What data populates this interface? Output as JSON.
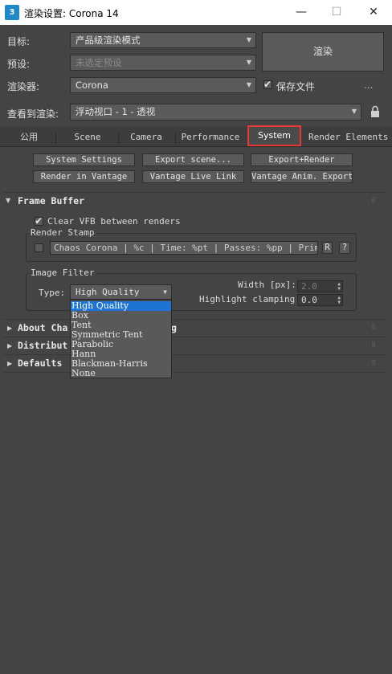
{
  "window": {
    "icon_label": "3",
    "title": "渲染设置: Corona 14",
    "minimize": "—",
    "maximize": "☐",
    "close": "✕"
  },
  "top": {
    "target_label": "目标:",
    "target_value": "产品级渲染模式",
    "preset_label": "预设:",
    "preset_value": "未选定预设",
    "renderer_label": "渲染器:",
    "renderer_value": "Corona",
    "save_file_label": "保存文件",
    "more_label": "...",
    "render_button": "渲染",
    "view_label": "查看到渲染:",
    "view_value": "浮动视口 - 1 - 透视"
  },
  "tabs": [
    "公用",
    "Scene",
    "Camera",
    "Performance",
    "System",
    "Render Elements"
  ],
  "active_tab": "System",
  "system_buttons": {
    "system_settings": "System Settings",
    "export_scene": "Export scene...",
    "export_render": "Export+Render",
    "render_vantage": "Render in Vantage",
    "vantage_live": "Vantage Live Link",
    "vantage_anim": "Vantage Anim. Export"
  },
  "frame_buffer": {
    "header": "Frame Buffer",
    "clear_vfb": "Clear VFB between renders",
    "render_stamp_title": "Render Stamp",
    "stamp_text": "Chaos Corona | %c | Time: %pt | Passes: %pp | Primitiv",
    "stamp_r": "R",
    "stamp_help": "?",
    "image_filter_title": "Image Filter",
    "type_label": "Type:",
    "type_value": "High Quality",
    "width_label": "Width [px]:",
    "width_value": "2.0",
    "highlight_label": "Highlight clamping:",
    "highlight_value": "0.0"
  },
  "filter_options": [
    "High Quality",
    "Box",
    "Tent",
    "Symmetric Tent",
    "Parabolic",
    "Hann",
    "Blackman-Harris",
    "None"
  ],
  "rollouts": {
    "about": "About Cha",
    "about_tail": "g",
    "distributed": "Distribut",
    "defaults": "Defaults"
  },
  "icons": {
    "lock": "lock-icon",
    "collapse": "triangle-icon"
  }
}
